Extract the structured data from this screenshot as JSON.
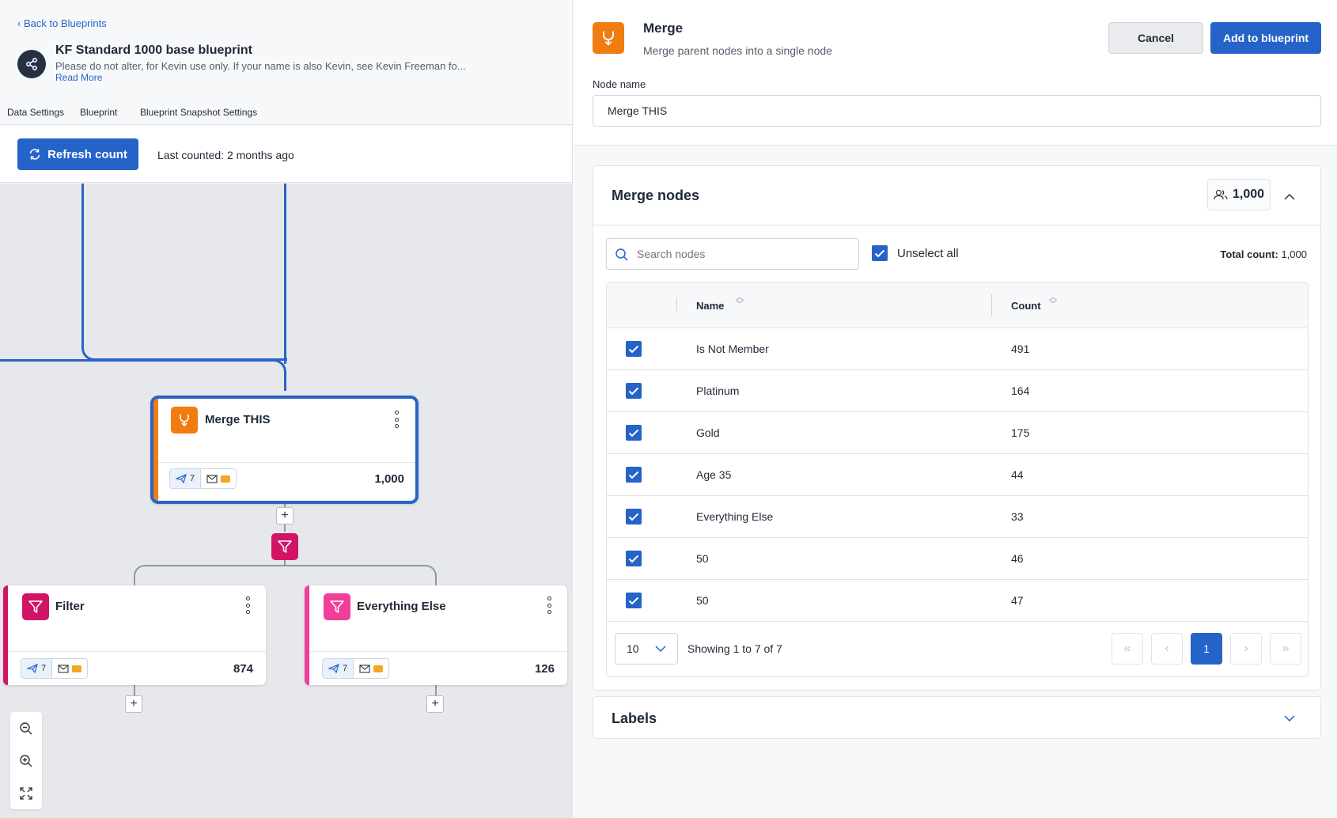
{
  "header": {
    "back_label": "Back to Blueprints",
    "title": "KF Standard 1000 base blueprint",
    "description": "Please do not alter, for Kevin use only. If your name is also Kevin, see Kevin Freeman fo...",
    "read_more": "Read More",
    "tabs": [
      "Data Settings",
      "Blueprint",
      "Blueprint Snapshot Settings"
    ]
  },
  "toolbar": {
    "refresh_label": "Refresh count",
    "last_counted": "Last counted: 2 months ago"
  },
  "canvas": {
    "merge_node": {
      "title": "Merge THIS",
      "chip_count": "7",
      "count": "1,000"
    },
    "filter_node": {
      "title": "Filter",
      "chip_count": "7",
      "count": "874"
    },
    "else_node": {
      "title": "Everything Else",
      "chip_count": "7",
      "count": "126"
    },
    "plus": "+"
  },
  "panel": {
    "title": "Merge",
    "subtitle": "Merge parent nodes into a single node",
    "cancel_label": "Cancel",
    "add_label": "Add to blueprint",
    "node_name_label": "Node name",
    "node_name_value": "Merge THIS",
    "merge_nodes": {
      "title": "Merge nodes",
      "count_badge": "1,000",
      "search_placeholder": "Search nodes",
      "unselect_label": "Unselect all",
      "total_label": "Total count:",
      "total_value": "1,000",
      "columns": {
        "name": "Name",
        "count": "Count"
      },
      "rows": [
        {
          "name": "Is Not Member",
          "count": "491"
        },
        {
          "name": "Platinum",
          "count": "164"
        },
        {
          "name": "Gold",
          "count": "175"
        },
        {
          "name": "Age 35",
          "count": "44"
        },
        {
          "name": "Everything Else",
          "count": "33"
        },
        {
          "name": "50",
          "count": "46"
        },
        {
          "name": "50",
          "count": "47"
        }
      ],
      "page_size": "10",
      "showing": "Showing 1 to 7 of 7",
      "current_page": "1"
    },
    "labels_title": "Labels"
  },
  "colors": {
    "primary": "#2563c9",
    "merge_orange": "#f07c12",
    "filter_magenta": "#d11466",
    "else_pink": "#f03e9a"
  }
}
